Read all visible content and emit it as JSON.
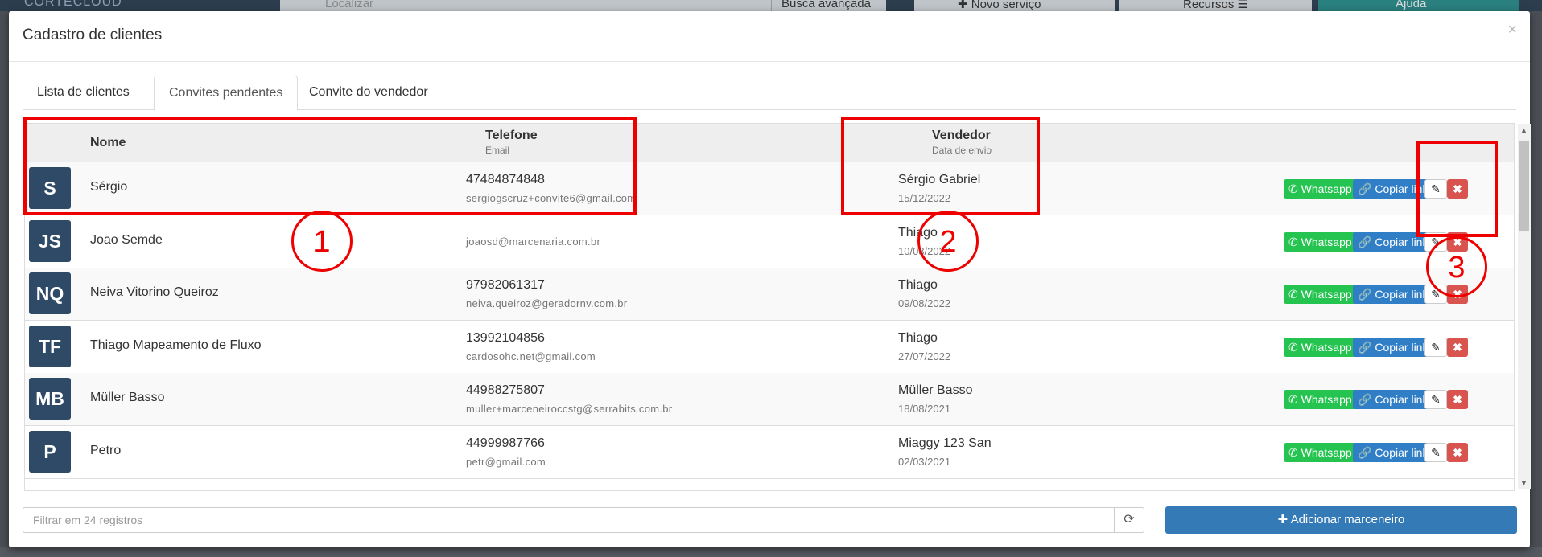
{
  "background": {
    "logo": "CORTECLOUD",
    "search_placeholder": "Localizar",
    "busca_label": "Busca avançada",
    "novo_label": "✚ Novo serviço",
    "recursos_label": "Recursos ☰",
    "ajuda_label": "Ajuda"
  },
  "modal": {
    "title": "Cadastro de clientes",
    "close": "×"
  },
  "tabs": [
    {
      "label": "Lista de clientes"
    },
    {
      "label": "Convites pendentes",
      "active": true
    },
    {
      "label": "Convite do vendedor"
    }
  ],
  "table": {
    "headers": {
      "nome": "Nome",
      "telefone": "Telefone",
      "email": "Email",
      "vendedor": "Vendedor",
      "data_envio": "Data de envio"
    },
    "rows": [
      {
        "initials": "S",
        "name": "Sérgio",
        "phone": "47484874848",
        "email": "sergiogscruz+convite6@gmail.com",
        "seller": "Sérgio Gabriel",
        "date": "15/12/2022"
      },
      {
        "initials": "JS",
        "name": "Joao Semde",
        "phone": "",
        "email": "joaosd@marcenaria.com.br",
        "seller": "Thiago",
        "date": "10/08/2022"
      },
      {
        "initials": "NQ",
        "name": "Neiva Vitorino Queiroz",
        "phone": "97982061317",
        "email": "neiva.queiroz@geradornv.com.br",
        "seller": "Thiago",
        "date": "09/08/2022"
      },
      {
        "initials": "TF",
        "name": "Thiago Mapeamento de Fluxo",
        "phone": "13992104856",
        "email": "cardosohc.net@gmail.com",
        "seller": "Thiago",
        "date": "27/07/2022"
      },
      {
        "initials": "MB",
        "name": "Müller Basso",
        "phone": "44988275807",
        "email": "muller+marceneiroccstg@serrabits.com.br",
        "seller": "Müller Basso",
        "date": "18/08/2021"
      },
      {
        "initials": "P",
        "name": "Petro",
        "phone": "44999987766",
        "email": "petr@gmail.com",
        "seller": "Miaggy 123 San",
        "date": "02/03/2021"
      }
    ],
    "actions": {
      "whatsapp": "Whatsapp",
      "copiar_link": "Copiar link",
      "edit_icon": "✎",
      "delete_icon": "✖"
    }
  },
  "footer": {
    "filter_placeholder": "Filtrar em 24 registros",
    "add_label": "✚ Adicionar marceneiro"
  },
  "annotations": {
    "marker1": "1",
    "marker2": "2",
    "marker3": "3"
  },
  "colors": {
    "whatsapp": "#25c451",
    "copy": "#2f7ec6",
    "delete": "#d9534f",
    "add": "#337ab7",
    "avatar": "#2e4a66",
    "annotation": "#e00000"
  }
}
